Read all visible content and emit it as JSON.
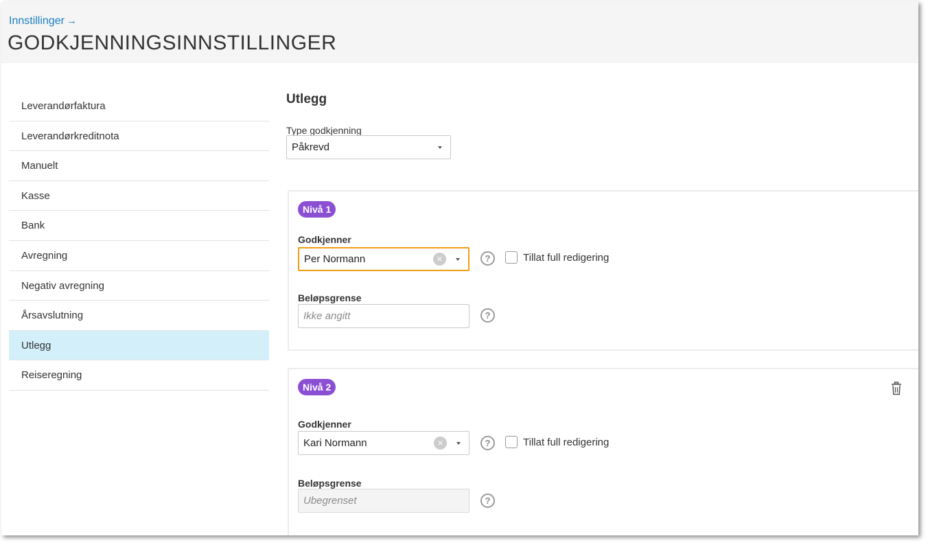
{
  "header": {
    "breadcrumb": "Innstillinger",
    "breadcrumb_arrow": "→",
    "title": "GODKJENNINGSINNSTILLINGER"
  },
  "sidebar": {
    "items": [
      {
        "label": "Leverandørfaktura"
      },
      {
        "label": "Leverandørkreditnota"
      },
      {
        "label": "Manuelt"
      },
      {
        "label": "Kasse"
      },
      {
        "label": "Bank"
      },
      {
        "label": "Avregning"
      },
      {
        "label": "Negativ avregning"
      },
      {
        "label": "Årsavslutning"
      },
      {
        "label": "Utlegg",
        "active": true
      },
      {
        "label": "Reiseregning"
      }
    ]
  },
  "main": {
    "section_title": "Utlegg",
    "type_label": "Type godkjenning",
    "type_value": "Påkrevd",
    "levels": [
      {
        "badge": "Nivå 1",
        "approver_label": "Godkjenner",
        "approver_value": "Per Normann",
        "checkbox_label": "Tillat full redigering",
        "limit_label": "Beløpsgrense",
        "limit_placeholder": "Ikke angitt"
      },
      {
        "badge": "Nivå 2",
        "approver_label": "Godkjenner",
        "approver_value": "Kari Normann",
        "checkbox_label": "Tillat full redigering",
        "limit_label": "Beløpsgrense",
        "limit_placeholder": "Ubegrenset"
      }
    ]
  },
  "icons": {
    "help": "?",
    "clear": "×"
  },
  "colors": {
    "badge": "#8b4fd3",
    "active_item": "#d2effa",
    "focus_border": "#f39c12",
    "link": "#1a7fc1"
  }
}
